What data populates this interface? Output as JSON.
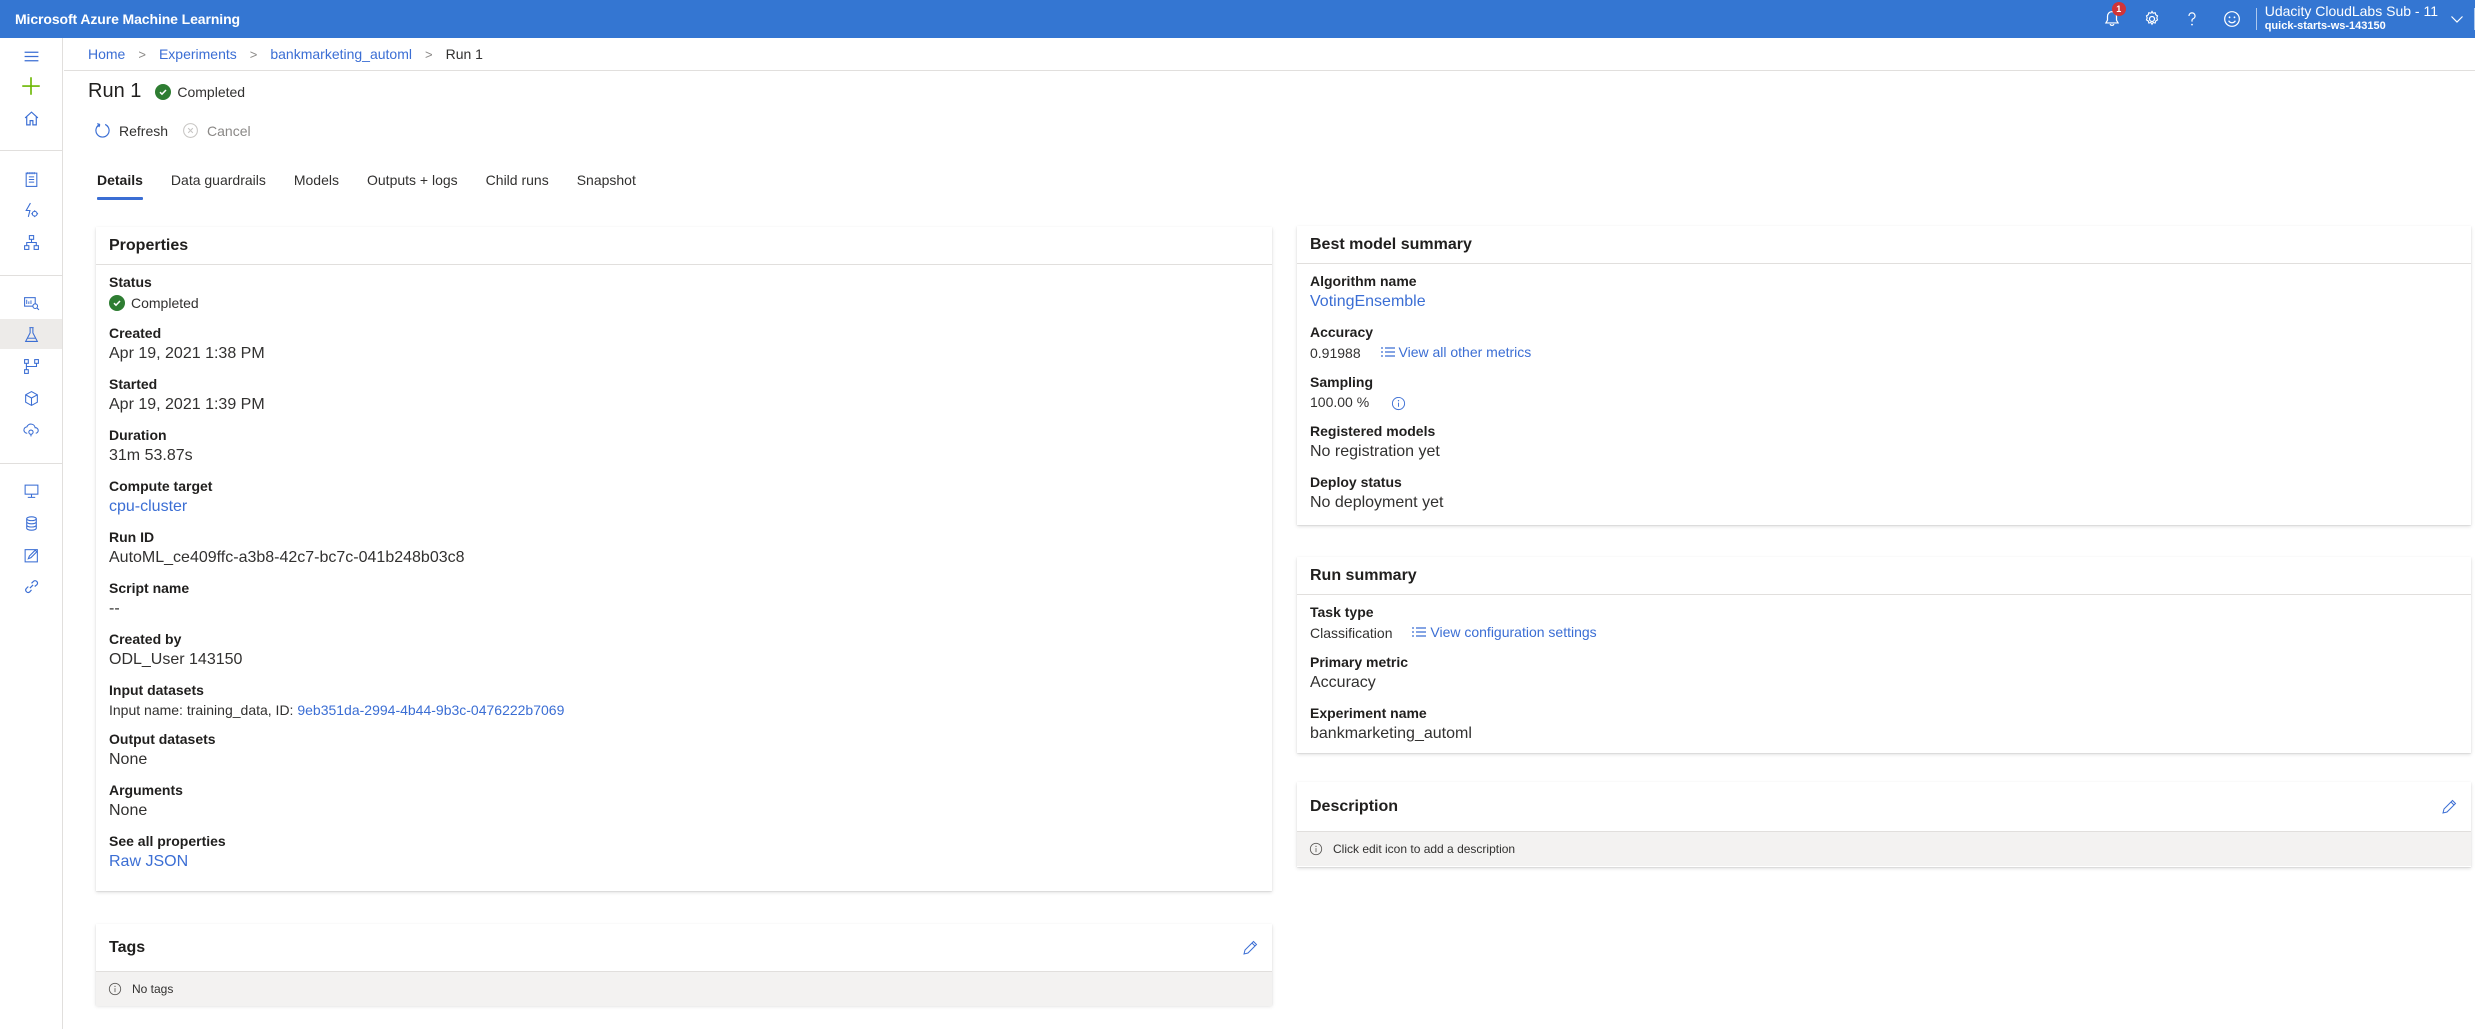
{
  "topbar": {
    "app_title": "Microsoft Azure Machine Learning",
    "notification_count": "1",
    "account_subscription": "Udacity CloudLabs Sub - 11",
    "account_workspace": "quick-starts-ws-143150",
    "icons": [
      "bell-icon",
      "gear-icon",
      "help-icon",
      "feedback-smiley-icon",
      "chevron-down-icon"
    ]
  },
  "leftnav": {
    "items": [
      {
        "name": "menu",
        "icon": "hamburger-icon"
      },
      {
        "name": "new",
        "icon": "plus-icon"
      },
      {
        "name": "home",
        "icon": "home-icon"
      },
      {
        "name": "notebooks",
        "icon": "notebook-icon"
      },
      {
        "name": "automated-ml",
        "icon": "automl-icon"
      },
      {
        "name": "designer",
        "icon": "designer-icon"
      },
      {
        "name": "datasets",
        "icon": "datasets-icon"
      },
      {
        "name": "experiments",
        "icon": "flask-icon",
        "active": true
      },
      {
        "name": "pipelines",
        "icon": "pipeline-icon"
      },
      {
        "name": "models",
        "icon": "cube-icon"
      },
      {
        "name": "endpoints",
        "icon": "cloud-endpoint-icon"
      },
      {
        "name": "compute",
        "icon": "compute-icon"
      },
      {
        "name": "datastores",
        "icon": "database-icon"
      },
      {
        "name": "data-labeling",
        "icon": "edit-box-icon"
      },
      {
        "name": "linked-services",
        "icon": "link-icon"
      }
    ]
  },
  "breadcrumb": {
    "items": [
      "Home",
      "Experiments",
      "bankmarketing_automl"
    ],
    "current": "Run 1",
    "separator": ">"
  },
  "header": {
    "title": "Run 1",
    "status": "Completed"
  },
  "commands": {
    "refresh": "Refresh",
    "cancel": "Cancel"
  },
  "tabs": [
    {
      "label": "Details",
      "active": true
    },
    {
      "label": "Data guardrails"
    },
    {
      "label": "Models"
    },
    {
      "label": "Outputs + logs"
    },
    {
      "label": "Child runs"
    },
    {
      "label": "Snapshot"
    }
  ],
  "properties": {
    "title": "Properties",
    "status_label": "Status",
    "status_value": "Completed",
    "created_label": "Created",
    "created_value": "Apr 19, 2021 1:38 PM",
    "started_label": "Started",
    "started_value": "Apr 19, 2021 1:39 PM",
    "duration_label": "Duration",
    "duration_value": "31m 53.87s",
    "compute_label": "Compute target",
    "compute_value": "cpu-cluster",
    "runid_label": "Run ID",
    "runid_value": "AutoML_ce409ffc-a3b8-42c7-bc7c-041b248b03c8",
    "script_label": "Script name",
    "script_value": "--",
    "createdby_label": "Created by",
    "createdby_value": "ODL_User 143150",
    "input_label": "Input datasets",
    "input_prefix": "Input name: training_data, ID: ",
    "input_id": "9eb351da-2994-4b44-9b3c-0476222b7069",
    "output_label": "Output datasets",
    "output_value": "None",
    "arguments_label": "Arguments",
    "arguments_value": "None",
    "seeall_label": "See all properties",
    "seeall_link": "Raw JSON"
  },
  "tags": {
    "title": "Tags",
    "empty_text": "No tags"
  },
  "best_model": {
    "title": "Best model summary",
    "algorithm_label": "Algorithm name",
    "algorithm_value": "VotingEnsemble",
    "accuracy_label": "Accuracy",
    "accuracy_value": "0.91988",
    "metrics_link": "View all other metrics",
    "sampling_label": "Sampling",
    "sampling_value": "100.00 %",
    "registered_label": "Registered models",
    "registered_value": "No registration yet",
    "deploy_label": "Deploy status",
    "deploy_value": "No deployment yet"
  },
  "run_summary": {
    "title": "Run summary",
    "task_label": "Task type",
    "task_value": "Classification",
    "config_link": "View configuration settings",
    "metric_label": "Primary metric",
    "metric_value": "Accuracy",
    "experiment_label": "Experiment name",
    "experiment_value": "bankmarketing_automl"
  },
  "description": {
    "title": "Description",
    "empty_text": "Click edit icon to add a description"
  },
  "colors": {
    "topbar": "#3476d2",
    "link": "#3b6ed4",
    "success": "#2e7d32",
    "badge": "#d13438",
    "add_icon": "#6bb700"
  }
}
